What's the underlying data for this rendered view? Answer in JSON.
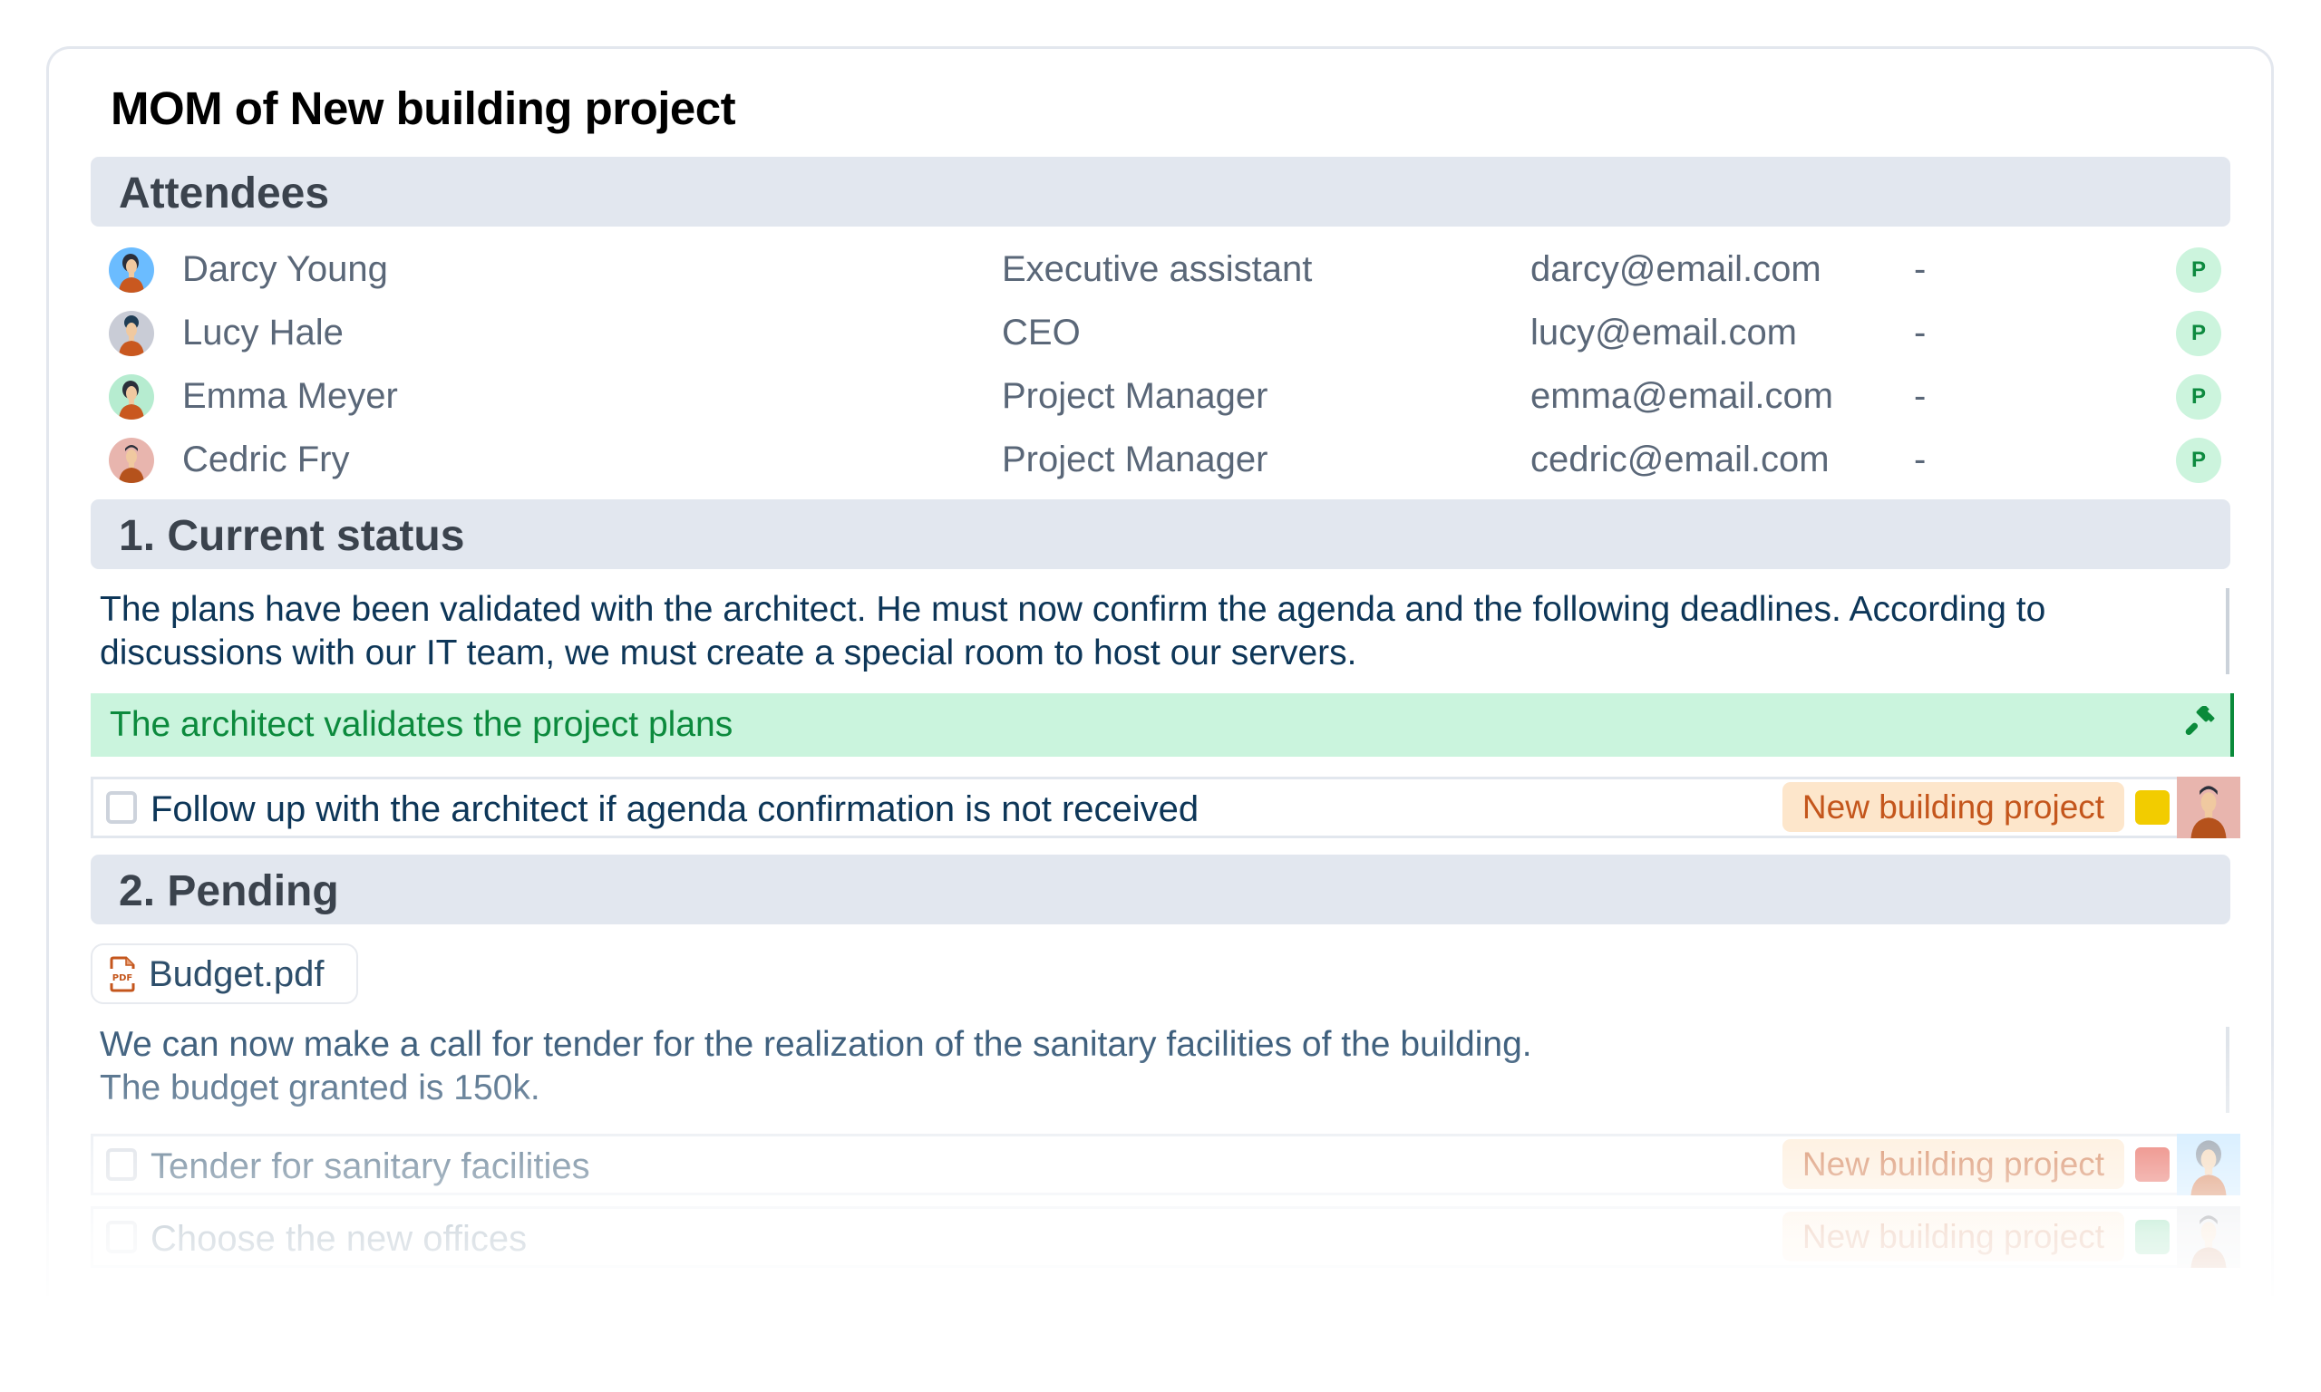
{
  "document": {
    "title": "MOM of New building project"
  },
  "attendees": {
    "header": "Attendees",
    "rows": [
      {
        "name": "Darcy Young",
        "role": "Executive assistant",
        "email": "darcy@email.com",
        "note": "-",
        "status": "P",
        "avatar_bg": "#6bbcff"
      },
      {
        "name": "Lucy Hale",
        "role": "CEO",
        "email": "lucy@email.com",
        "note": "-",
        "status": "P",
        "avatar_bg": "#c9ccd6"
      },
      {
        "name": "Emma Meyer",
        "role": "Project Manager",
        "email": "emma@email.com",
        "note": "-",
        "status": "P",
        "avatar_bg": "#b6ecd0"
      },
      {
        "name": "Cedric Fry",
        "role": "Project Manager",
        "email": "cedric@email.com",
        "note": "-",
        "status": "P",
        "avatar_bg": "#e8b5ae"
      }
    ]
  },
  "sections": [
    {
      "header": "1. Current status",
      "paragraph": "The plans have been validated with the architect. He must now confirm the agenda and the following deadlines. According to discussions with our IT team, we must create a special room to host our servers.",
      "decision": {
        "text": "The architect validates the project plans",
        "icon": "gavel-icon"
      },
      "tasks": [
        {
          "text": "Follow up with the architect if agenda confirmation is not received",
          "checked": false,
          "tag": "New building project",
          "priority_color": "#f2cc00",
          "assignee_bg": "#e8b5ae"
        }
      ]
    },
    {
      "header": "2. Pending",
      "attachment": {
        "name": "Budget.pdf",
        "icon": "pdf-file-icon"
      },
      "paragraph_lines": [
        "We can now make a call for tender for the realization of the sanitary facilities of the building.",
        "The budget granted is 150k."
      ],
      "tasks": [
        {
          "text": "Tender for sanitary facilities",
          "checked": false,
          "tag": "New building project",
          "priority_color": "#e03c2e",
          "assignee_bg": "#bde3ff"
        },
        {
          "text": "Choose the new offices",
          "checked": false,
          "tag": "New building project",
          "priority_color": "#2fbf71",
          "assignee_bg": "#d9dde3"
        }
      ]
    }
  ],
  "colors": {
    "section_header_bg": "#e2e7ef",
    "decision_bg": "#caf4dd",
    "decision_accent": "#0a8a3a",
    "tag_bg": "#fde6cb",
    "tag_text": "#c4561c",
    "presence_badge_bg": "#ccf4dd"
  }
}
